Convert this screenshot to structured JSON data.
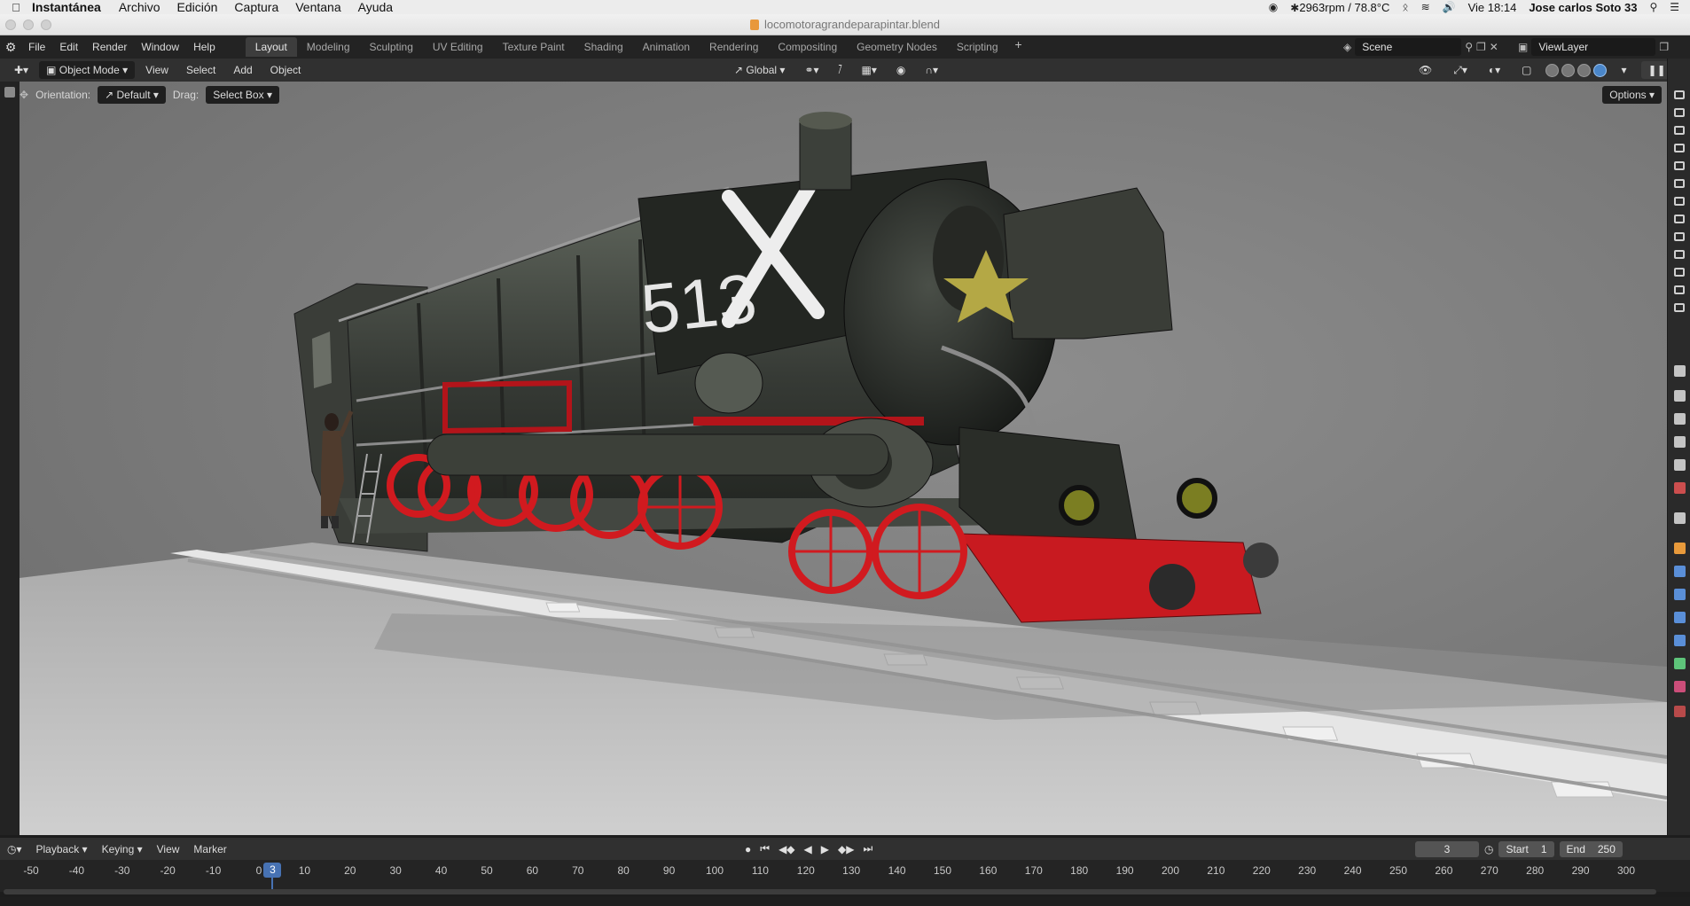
{
  "mac_menu": {
    "app": "Instantánea",
    "items": [
      "Archivo",
      "Edición",
      "Captura",
      "Ventana",
      "Ayuda"
    ],
    "status_cpu": "2963rpm / 78.8°C",
    "clock": "Vie 18:14",
    "user": "Jose carlos Soto 33"
  },
  "window": {
    "title": "locomotoragrandeparapintar.blend"
  },
  "blender_menu": [
    "File",
    "Edit",
    "Render",
    "Window",
    "Help"
  ],
  "workspaces": {
    "active": "Layout",
    "tabs": [
      "Layout",
      "Modeling",
      "Sculpting",
      "UV Editing",
      "Texture Paint",
      "Shading",
      "Animation",
      "Rendering",
      "Compositing",
      "Geometry Nodes",
      "Scripting"
    ],
    "add": "+"
  },
  "scene": {
    "name": "Scene"
  },
  "view_layer": {
    "name": "ViewLayer"
  },
  "viewport_header": {
    "mode": "Object Mode",
    "menus": [
      "View",
      "Select",
      "Add",
      "Object"
    ],
    "transform": "Global"
  },
  "tool_header": {
    "orientation_label": "Orientation:",
    "orientation_value": "Default",
    "drag_label": "Drag:",
    "drag_value": "Select Box",
    "options": "Options"
  },
  "scene_content": {
    "locomotive_number": "513"
  },
  "timeline": {
    "menus": [
      "Playback",
      "Keying",
      "View",
      "Marker"
    ],
    "current_frame": "3",
    "start_label": "Start",
    "start": "1",
    "end_label": "End",
    "end": "250",
    "ticks": [
      "-50",
      "-40",
      "-30",
      "-20",
      "-10",
      "0",
      "10",
      "20",
      "30",
      "40",
      "50",
      "60",
      "70",
      "80",
      "90",
      "100",
      "110",
      "120",
      "130",
      "140",
      "150",
      "160",
      "170",
      "180",
      "190",
      "200",
      "210",
      "220",
      "230",
      "240",
      "250",
      "260",
      "270",
      "280",
      "290",
      "300"
    ]
  },
  "colors": {
    "accent": "#4772b3",
    "wheel_red": "#d11a1f",
    "boiler": "#2f332e"
  }
}
